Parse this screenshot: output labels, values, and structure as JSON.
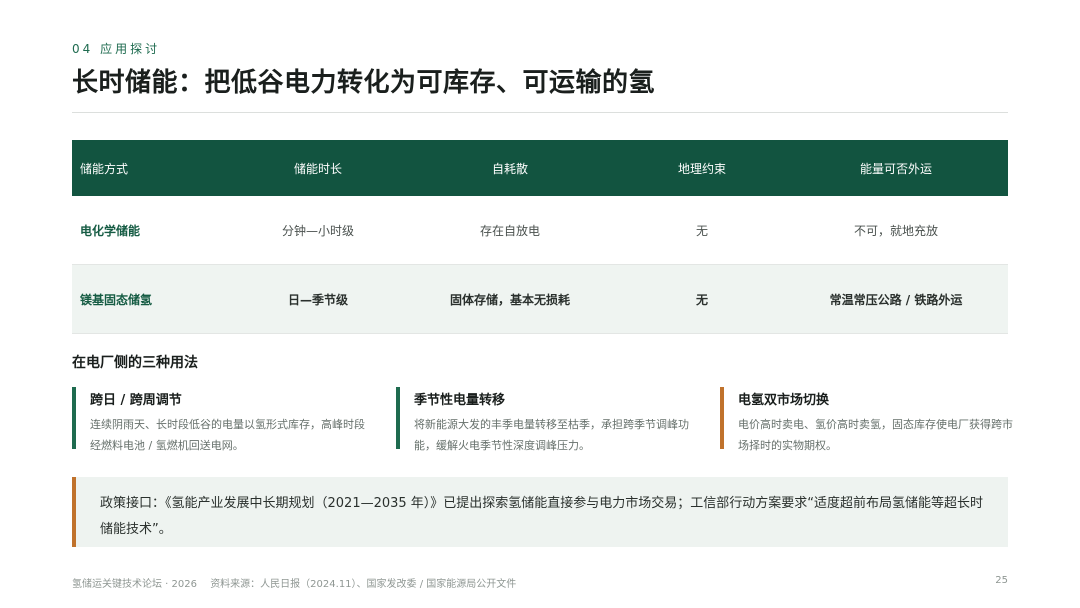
{
  "header": {
    "section_tag": "04 应用探讨",
    "title": "长时储能：把低谷电力转化为可库存、可运输的氢"
  },
  "table": {
    "columns": [
      "储能方式",
      "储能时长",
      "自耗散",
      "地理约束",
      "能量可否外运"
    ],
    "rows": [
      [
        "电化学储能",
        "分钟—小时级",
        "存在自放电",
        "无",
        "不可，就地充放"
      ],
      [
        "镁基固态储氢",
        "日—季节级",
        "固体存储，基本无损耗",
        "无",
        "常温常压公路 / 铁路外运"
      ]
    ]
  },
  "uses": {
    "heading": "在电厂侧的三种用法",
    "cards": [
      {
        "title": "跨日 / 跨周调节",
        "body": "连续阴雨天、长时段低谷的电量以氢形式库存，高峰时段经燃料电池 / 氢燃机回送电网。",
        "accent": "#1e6b4f"
      },
      {
        "title": "季节性电量转移",
        "body": "将新能源大发的丰季电量转移至枯季，承担跨季节调峰功能，缓解火电季节性深度调峰压力。",
        "accent": "#1e6b4f"
      },
      {
        "title": "电氢双市场切换",
        "body": "电价高时卖电、氢价高时卖氢，固态库存使电厂获得跨市场择时的实物期权。",
        "accent": "#c0722c"
      }
    ]
  },
  "policy": {
    "text": "政策接口：《氢能产业发展中长期规划（2021—2035 年）》已提出探索氢储能直接参与电力市场交易；工信部行动方案要求“适度超前布局氢储能等超长时储能技术”。"
  },
  "footer": {
    "event": "氢储运关键技术论坛 · 2026",
    "source": "资料来源：人民日报（2024.11）、国家发改委 / 国家能源局公开文件",
    "page": "25"
  },
  "colors": {
    "primary_green": "#125440",
    "accent_green": "#1e6b4f",
    "accent_orange": "#c0722c",
    "panel_bg": "#eef3f0"
  }
}
